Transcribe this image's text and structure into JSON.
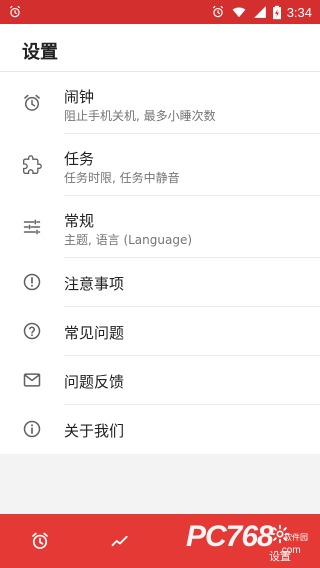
{
  "status_bar": {
    "time": "3:34",
    "icons": [
      "alarm-icon",
      "wifi-icon",
      "signal-icon",
      "battery-charging-icon"
    ]
  },
  "page_title": "设置",
  "settings": [
    {
      "icon": "alarm-clock-icon",
      "title": "闹钟",
      "subtitle": "阻止手机关机, 最多小睡次数"
    },
    {
      "icon": "puzzle-icon",
      "title": "任务",
      "subtitle": "任务时限, 任务中静音"
    },
    {
      "icon": "tune-icon",
      "title": "常规",
      "subtitle": "主题, 语言 (Language)"
    },
    {
      "icon": "alert-circle-icon",
      "title": "注意事项",
      "subtitle": ""
    },
    {
      "icon": "help-circle-icon",
      "title": "常见问题",
      "subtitle": ""
    },
    {
      "icon": "mail-icon",
      "title": "问题反馈",
      "subtitle": ""
    },
    {
      "icon": "info-circle-icon",
      "title": "关于我们",
      "subtitle": ""
    }
  ],
  "bottom_nav": {
    "items": [
      {
        "icon": "alarm-tab-icon",
        "label": ""
      },
      {
        "icon": "trend-chart-icon",
        "label": ""
      },
      {
        "icon": "settings-gear-icon",
        "label": "设置",
        "active": true
      }
    ]
  },
  "watermark": {
    "text": "PC768",
    "sub": "软件园",
    "domain": ".com"
  },
  "colors": {
    "accent": "#e53935",
    "status_bar": "#d32f2f",
    "text": "#212121",
    "subtext": "#757575"
  }
}
